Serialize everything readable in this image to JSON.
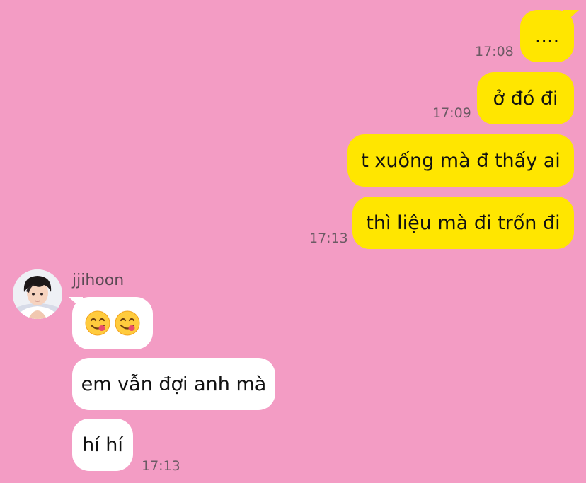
{
  "chat": {
    "outgoing": [
      {
        "text": "....",
        "time": "17:08"
      },
      {
        "text": "ở đó đi",
        "time": "17:09"
      },
      {
        "text": "t xuống mà đ thấy ai",
        "time": ""
      },
      {
        "text": "thì liệu mà đi trốn đi",
        "time": "17:13"
      }
    ],
    "incoming": {
      "sender_name": "jjihoon",
      "avatar_icon": "profile-photo",
      "messages": [
        {
          "text": "",
          "content": "two-yum-face-emojis",
          "time": ""
        },
        {
          "text": "em vẫn đợi anh mà",
          "time": ""
        },
        {
          "text": "hí hí",
          "time": "17:13"
        }
      ]
    }
  },
  "colors": {
    "background": "#f39cc4",
    "outgoing_bubble": "#ffe600",
    "incoming_bubble": "#ffffff",
    "timestamp": "#6c5a64"
  }
}
